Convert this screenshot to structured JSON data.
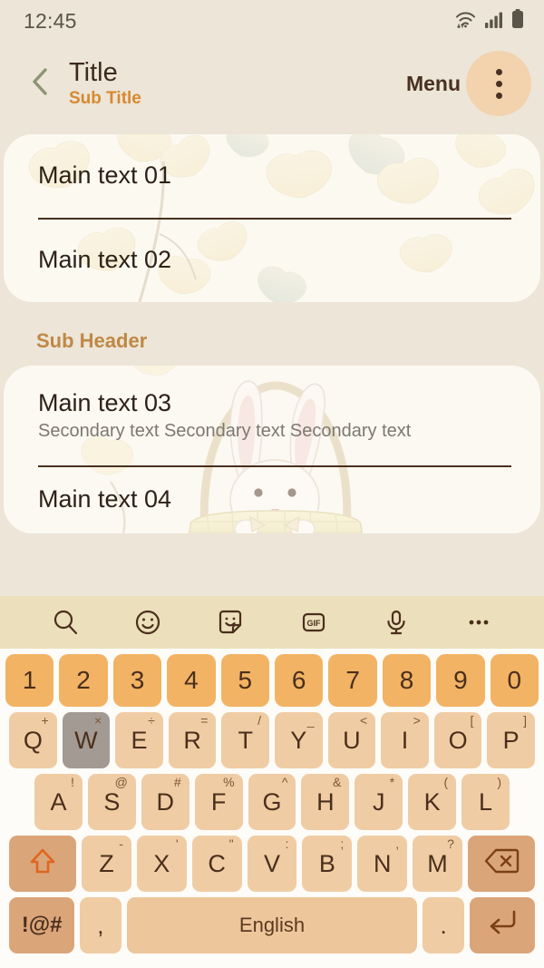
{
  "status_bar": {
    "time": "12:45",
    "icons": [
      "wifi-icon",
      "signal-icon",
      "battery-icon"
    ]
  },
  "app_bar": {
    "back_icon": "chevron-left-icon",
    "title": "Title",
    "subtitle": "Sub Title",
    "menu_label": "Menu",
    "overflow_icon": "more-vertical-icon"
  },
  "colors": {
    "page_background": "#ece5d8",
    "card_background": "#fbf8f0",
    "accent_orange": "#d8892f",
    "subheader": "#c08844",
    "title_text": "#3d2a1b",
    "divider": "#4a2f1c",
    "key_letter": "#f0cca4",
    "key_number": "#f2b364",
    "key_function": "#dba57a",
    "key_space": "#eec69b",
    "key_pressed": "#a39a94",
    "toolbar_background": "#ecdfbb",
    "menu_circle": "#f2d3ae"
  },
  "list": {
    "card_one": [
      {
        "main": "Main text 01"
      },
      {
        "main": "Main text 02"
      }
    ],
    "sub_header": "Sub Header",
    "card_two": [
      {
        "main": "Main text 03",
        "secondary": "Secondary text Secondary text Secondary text"
      },
      {
        "main": "Main text 04"
      }
    ]
  },
  "keyboard": {
    "toolbar": [
      {
        "name": "search-icon"
      },
      {
        "name": "emoji-icon"
      },
      {
        "name": "sticker-icon"
      },
      {
        "name": "gif-icon",
        "label": "GIF"
      },
      {
        "name": "microphone-icon"
      },
      {
        "name": "more-horizontal-icon"
      }
    ],
    "number_row": [
      "1",
      "2",
      "3",
      "4",
      "5",
      "6",
      "7",
      "8",
      "9",
      "0"
    ],
    "row_qwerty": [
      {
        "label": "Q",
        "sub": "+"
      },
      {
        "label": "W",
        "sub": "×",
        "pressed": true
      },
      {
        "label": "E",
        "sub": "÷"
      },
      {
        "label": "R",
        "sub": "="
      },
      {
        "label": "T",
        "sub": "/"
      },
      {
        "label": "Y",
        "sub": "_"
      },
      {
        "label": "U",
        "sub": "<"
      },
      {
        "label": "I",
        "sub": ">"
      },
      {
        "label": "O",
        "sub": "["
      },
      {
        "label": "P",
        "sub": "]"
      }
    ],
    "row_home": [
      {
        "label": "A",
        "sub": "!"
      },
      {
        "label": "S",
        "sub": "@"
      },
      {
        "label": "D",
        "sub": "#"
      },
      {
        "label": "F",
        "sub": "%"
      },
      {
        "label": "G",
        "sub": "^"
      },
      {
        "label": "H",
        "sub": "&"
      },
      {
        "label": "J",
        "sub": "*"
      },
      {
        "label": "K",
        "sub": "("
      },
      {
        "label": "L",
        "sub": ")"
      }
    ],
    "row_zxc": [
      {
        "label": "Z",
        "sub": "-"
      },
      {
        "label": "X",
        "sub": "'"
      },
      {
        "label": "C",
        "sub": "\""
      },
      {
        "label": "V",
        "sub": ":"
      },
      {
        "label": "B",
        "sub": ";"
      },
      {
        "label": "N",
        "sub": ","
      },
      {
        "label": "M",
        "sub": "?"
      }
    ],
    "shift_icon": "shift-arrow-icon",
    "backspace_icon": "backspace-icon",
    "symbols_key": "!@#",
    "comma_key": ",",
    "space_key": "English",
    "period_key": ".",
    "enter_icon": "enter-arrow-icon"
  }
}
